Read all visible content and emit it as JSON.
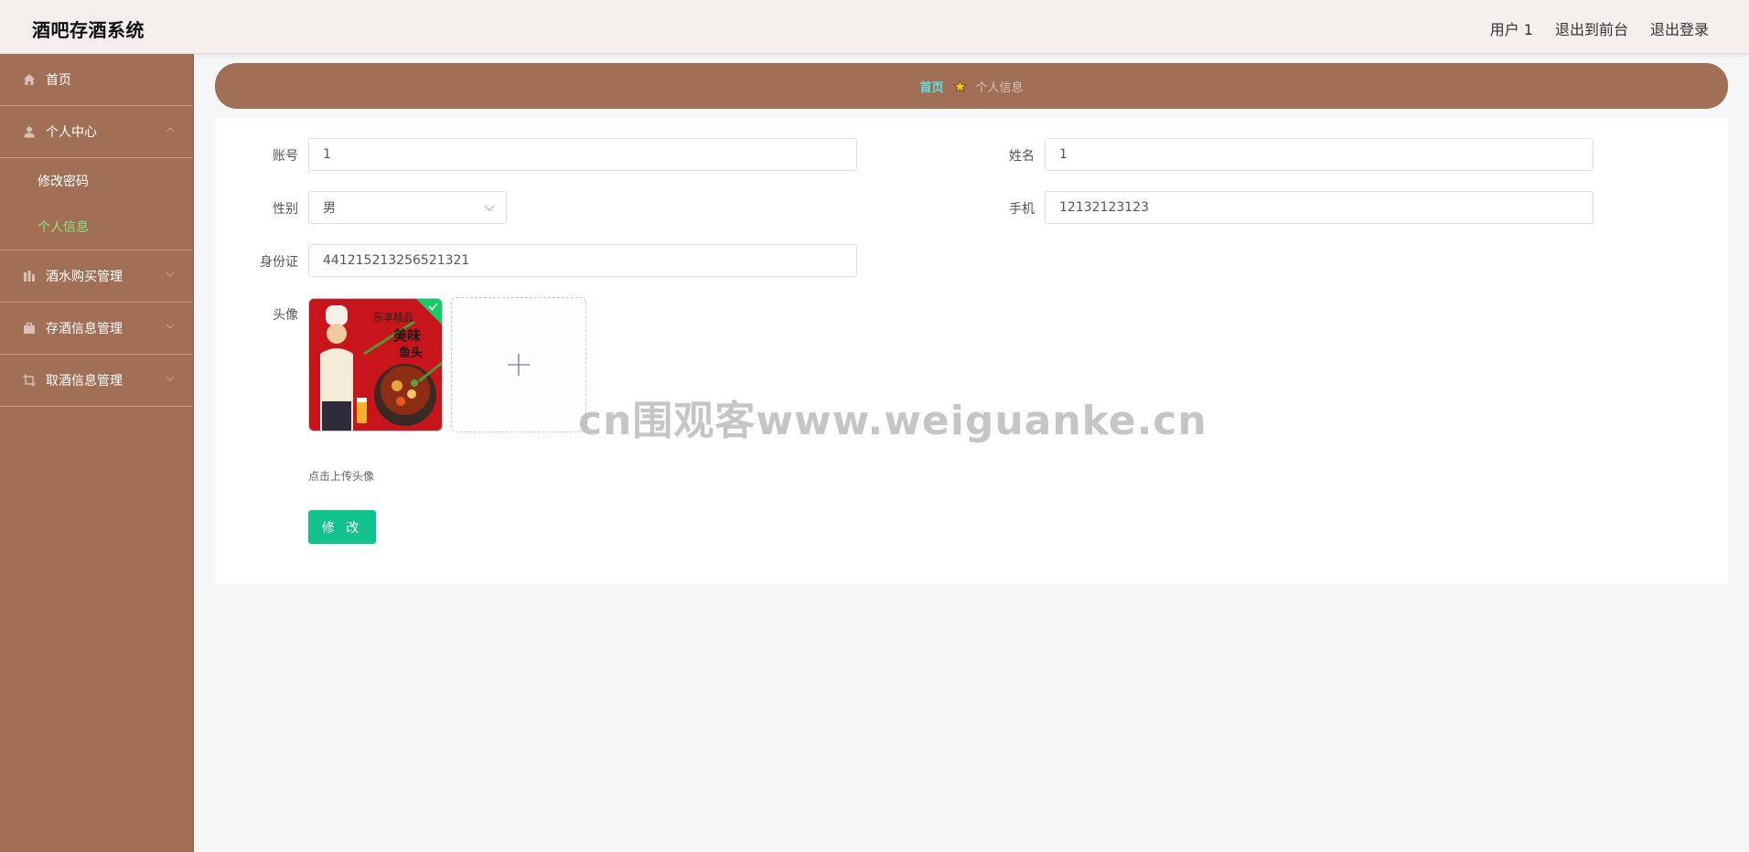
{
  "header": {
    "title": "酒吧存酒系统",
    "user": "用户 1",
    "to_front": "退出到前台",
    "logout": "退出登录"
  },
  "sidebar": {
    "home": "首页",
    "personal_center": "个人中心",
    "change_password": "修改密码",
    "personal_info": "个人信息",
    "purchase_mgmt": "酒水购买管理",
    "storage_mgmt": "存酒信息管理",
    "pickup_mgmt": "取酒信息管理"
  },
  "breadcrumb": {
    "home": "首页",
    "current": "个人信息"
  },
  "form": {
    "account_label": "账号",
    "account_value": "1",
    "name_label": "姓名",
    "name_value": "1",
    "gender_label": "性别",
    "gender_value": "男",
    "phone_label": "手机",
    "phone_value": "12132123123",
    "idcard_label": "身份证",
    "idcard_value": "441215213256521321",
    "avatar_label": "头像",
    "upload_tip": "点击上传头像",
    "submit_label": "修 改"
  },
  "watermark": "cn围观客www.weiguanke.cn",
  "colors": {
    "sidebar_bg": "#a06f55",
    "header_bg": "#f4eeed",
    "active_submenu": "#8fe37a",
    "breadcrumb_home": "#5ee2e8",
    "primary_button": "#13c28d"
  },
  "icons": {
    "home": "home-icon",
    "personal": "user-icon",
    "purchase": "chart-icon",
    "storage": "briefcase-icon",
    "pickup": "crop-icon",
    "breadcrumb_separator": "star-icon",
    "upload": "plus-icon",
    "upload_success": "check-icon"
  }
}
